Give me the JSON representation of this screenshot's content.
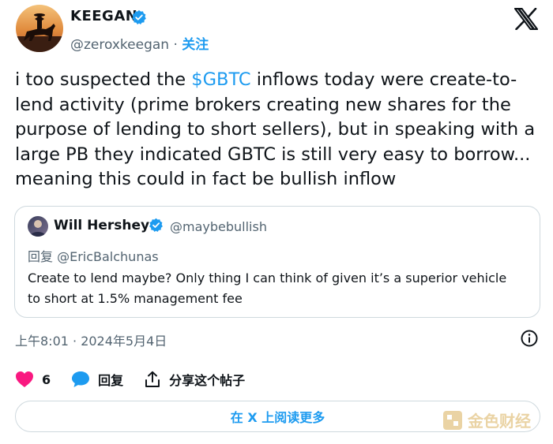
{
  "author": {
    "name": "KEEGAN",
    "handle": "@zeroxkeegan",
    "separator": "·",
    "follow_label": "关注"
  },
  "tweet": {
    "text_before": "i too suspected the ",
    "cashtag": "$GBTC",
    "text_after": " inflows today were create-to-lend activity (prime brokers creating new shares for the purpose of lending to short sellers), but in speaking with a large PB they indicated GBTC is still very easy to borrow... meaning this could in fact be bullish inflow"
  },
  "quote": {
    "name": "Will Hershey",
    "handle": "@maybebullish",
    "reply_to": "回复 @EricBalchunas",
    "text": "Create to lend maybe? Only thing I can think of given it’s a superior vehicle to short at 1.5% management fee"
  },
  "timestamp": "上午8:01 · 2024年5月4日",
  "actions": {
    "like_count": "6",
    "reply_label": "回复",
    "share_label": "分享这个帖子"
  },
  "read_more_label": "在 X 上阅读更多",
  "watermark": "金色财经",
  "icons": {
    "brand": "x-logo-icon",
    "verified": "verified-badge-icon",
    "info": "info-icon",
    "like": "heart-icon",
    "reply": "reply-bubble-icon",
    "share": "share-icon"
  },
  "colors": {
    "accent": "#1d9bf0",
    "like": "#f91880",
    "muted": "#536471",
    "text": "#0f1419",
    "watermark": "#e3c586"
  }
}
